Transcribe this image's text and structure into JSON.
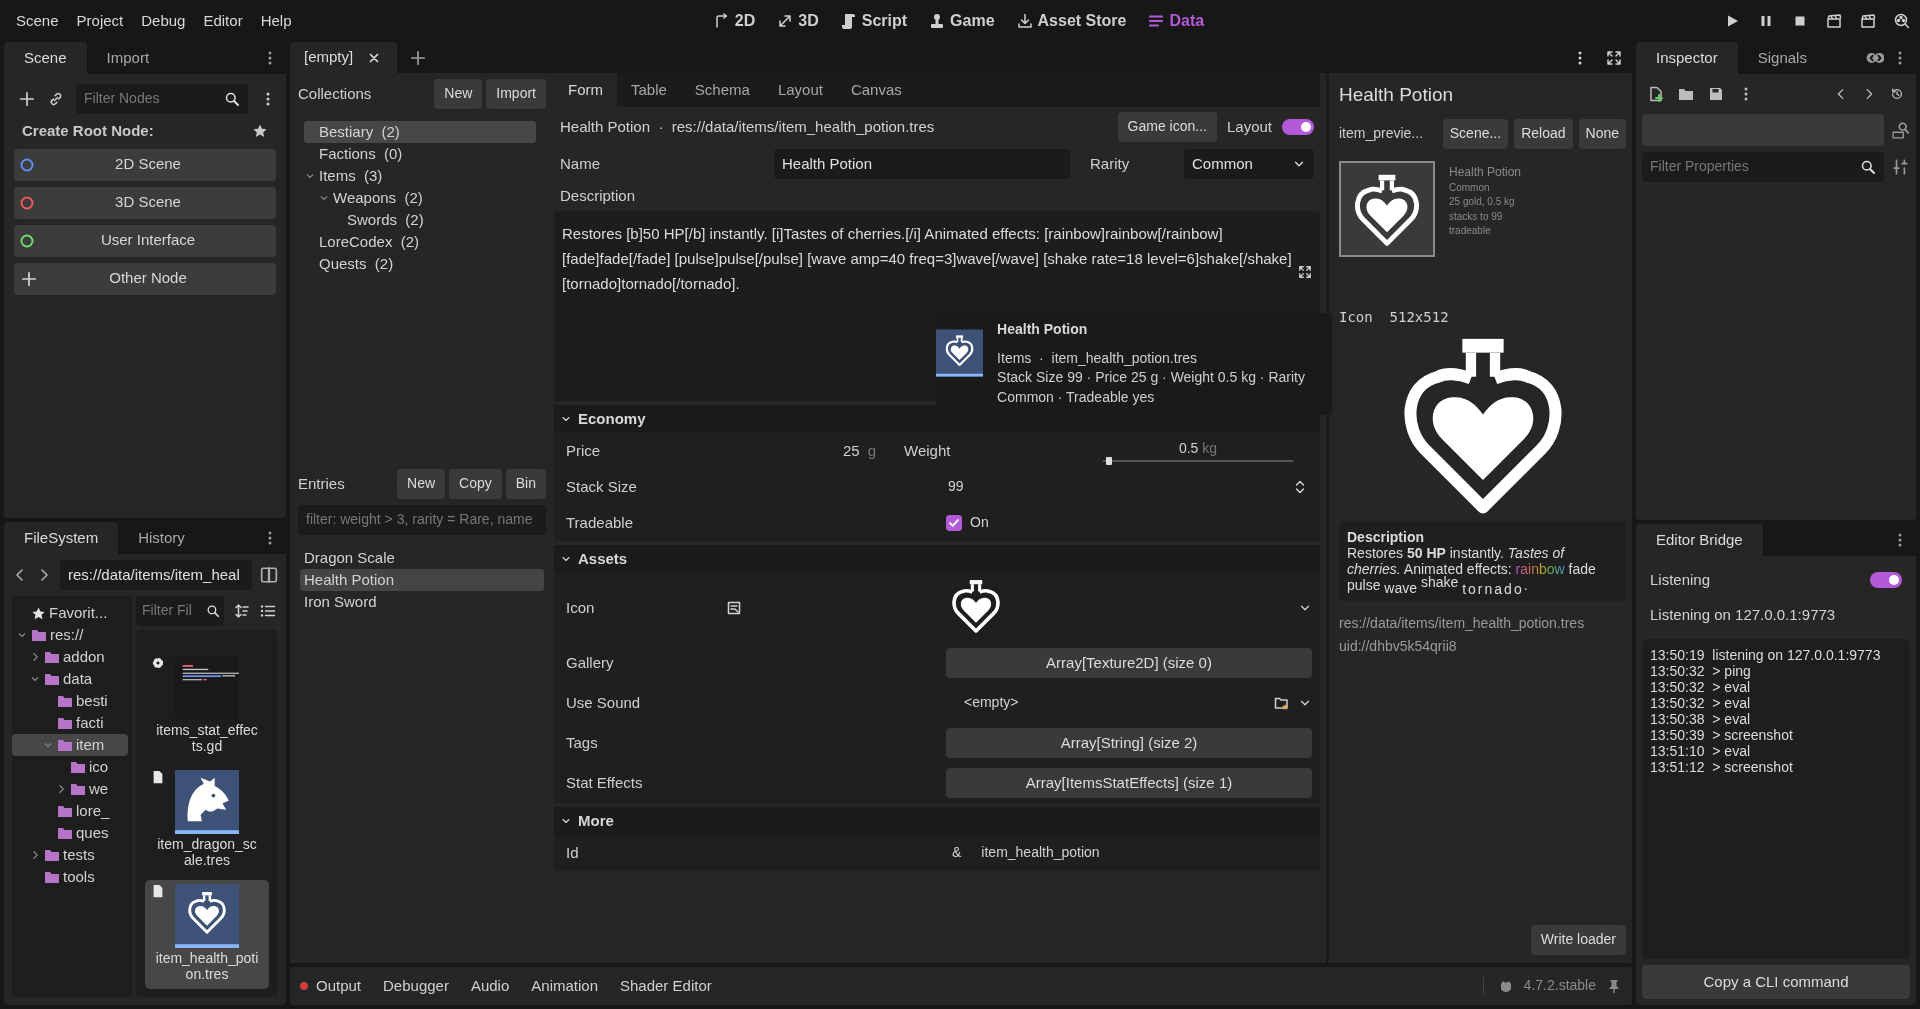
{
  "menu": [
    "Scene",
    "Project",
    "Debug",
    "Editor",
    "Help"
  ],
  "workspaces": [
    {
      "label": "2D",
      "kind": "flat",
      "selected": false
    },
    {
      "label": "3D",
      "kind": "spatial",
      "selected": false
    },
    {
      "label": "Script",
      "kind": "script",
      "selected": false
    },
    {
      "label": "Game",
      "kind": "game",
      "selected": false
    },
    {
      "label": "Asset Store",
      "kind": "store",
      "selected": false
    },
    {
      "label": "Data",
      "kind": "data",
      "selected": true
    }
  ],
  "scene_dock": {
    "tabs": [
      {
        "label": "Scene",
        "selected": true
      },
      {
        "label": "Import",
        "selected": false
      }
    ],
    "filter": {
      "placeholder": "Filter Nodes"
    },
    "heading": "Create Root Node:",
    "root_buttons": [
      {
        "label": "2D Scene",
        "kind": "circle",
        "color": "#5b8ff0"
      },
      {
        "label": "3D Scene",
        "kind": "circle",
        "color": "#ef5a5a"
      },
      {
        "label": "User Interface",
        "kind": "circle",
        "color": "#6fdc6f"
      },
      {
        "label": "Other Node",
        "kind": "plus"
      }
    ]
  },
  "filesystem": {
    "tabs": [
      {
        "label": "FileSystem",
        "selected": true
      },
      {
        "label": "History",
        "selected": false
      }
    ],
    "path": "res://data/items/item_heal",
    "tree": [
      {
        "label": "Favorit...",
        "kind": "favorites",
        "selected": false
      },
      {
        "label": "res://",
        "kind": "folder",
        "expanded": true,
        "selected": false,
        "children": [
          {
            "label": "addon",
            "kind": "folder",
            "expanded": false,
            "selected": false
          },
          {
            "label": "data",
            "kind": "folder",
            "expanded": true,
            "selected": false,
            "children": [
              {
                "label": "besti",
                "kind": "folder",
                "selected": false
              },
              {
                "label": "facti",
                "kind": "folder",
                "selected": false
              },
              {
                "label": "item",
                "kind": "folder",
                "expanded": true,
                "selected": true,
                "children": [
                  {
                    "label": "ico",
                    "kind": "folder",
                    "selected": false
                  },
                  {
                    "label": "we",
                    "kind": "folder",
                    "expanded": false,
                    "selected": false
                  }
                ]
              },
              {
                "label": "lore_",
                "kind": "folder",
                "selected": false
              },
              {
                "label": "ques",
                "kind": "folder",
                "selected": false
              }
            ]
          },
          {
            "label": "tests",
            "kind": "folder",
            "expanded": false,
            "selected": false
          },
          {
            "label": "tools",
            "kind": "folder",
            "selected": false
          }
        ]
      }
    ],
    "filter": {
      "placeholder": "Filter Fil"
    },
    "files": [
      {
        "name": "items_stat_effects.gd",
        "kind": "script",
        "selected": false
      },
      {
        "name": "item_dragon_scale.tres",
        "kind": "dragon",
        "selected": false
      },
      {
        "name": "item_health_potion.tres",
        "kind": "potion",
        "selected": true
      }
    ]
  },
  "scene_tabs": [
    {
      "label": "[empty]",
      "selected": true
    }
  ],
  "collections": {
    "title": "Collections",
    "buttons": [
      "New",
      "Import"
    ],
    "tree": [
      {
        "label": "Bestiary  (2)",
        "selected": true
      },
      {
        "label": "Factions  (0)",
        "selected": false
      },
      {
        "label": "Items  (3)",
        "expanded": true,
        "selected": false,
        "children": [
          {
            "label": "Weapons  (2)",
            "expanded": true,
            "selected": false,
            "children": [
              {
                "label": "Swords  (2)",
                "selected": false
              }
            ]
          }
        ]
      },
      {
        "label": "LoreCodex  (2)",
        "selected": false
      },
      {
        "label": "Quests  (2)",
        "selected": false
      }
    ]
  },
  "entries": {
    "title": "Entries",
    "buttons": [
      "New",
      "Copy",
      "Bin"
    ],
    "filter": {
      "placeholder": "filter: weight > 3, rarity = Rare, name"
    },
    "items": [
      {
        "label": "Dragon Scale",
        "selected": false
      },
      {
        "label": "Health Potion",
        "selected": true
      },
      {
        "label": "Iron Sword",
        "selected": false
      }
    ]
  },
  "form": {
    "tabs": [
      {
        "label": "Form",
        "selected": true
      },
      {
        "label": "Table",
        "selected": false
      },
      {
        "label": "Schema",
        "selected": false
      },
      {
        "label": "Layout",
        "selected": false
      },
      {
        "label": "Canvas",
        "selected": false
      }
    ],
    "breadcrumb": "Health Potion  ·  res://data/items/item_health_potion.tres",
    "icon_button": "Game icon...",
    "layout_toggle": {
      "label": "Layout",
      "on": true
    },
    "name": {
      "label": "Name",
      "value": "Health Potion"
    },
    "rarity": {
      "label": "Rarity",
      "value": "Common"
    },
    "description": {
      "label": "Description",
      "value": "Restores [b]50 HP[/b] instantly. [i]Tastes of cherries.[/i] Animated effects: [rainbow]rainbow[/rainbow] [fade]fade[/fade] [pulse]pulse[/pulse] [wave amp=40 freq=3]wave[/wave] [shake rate=18 level=6]shake[/shake] [tornado]tornado[/tornado]."
    },
    "sections": [
      {
        "title": "Economy",
        "expanded": true,
        "rows": [
          {
            "kind": "price",
            "label": "Price",
            "value": "25",
            "unit": "g",
            "label2": "Weight",
            "value2": "0.5",
            "unit2": "kg",
            "level": 0.03
          },
          {
            "kind": "spin",
            "label": "Stack Size",
            "value": "99"
          },
          {
            "kind": "check",
            "label": "Tradeable",
            "checked": true,
            "text": "On"
          }
        ]
      },
      {
        "title": "Assets",
        "expanded": true,
        "rows": [
          {
            "kind": "texture",
            "label": "Icon"
          },
          {
            "kind": "array",
            "label": "Gallery",
            "value": "Array[Texture2D] (size 0)"
          },
          {
            "kind": "resource",
            "label": "Use Sound",
            "value": "<empty>"
          },
          {
            "kind": "array",
            "label": "Tags",
            "value": "Array[String] (size 2)"
          },
          {
            "kind": "array",
            "label": "Stat Effects",
            "value": "Array[ItemsStatEffects] (size 1)"
          }
        ]
      },
      {
        "title": "More",
        "expanded": true,
        "rows": [
          {
            "kind": "id",
            "label": "Id",
            "prefix": "&",
            "value": "item_health_potion"
          }
        ]
      }
    ]
  },
  "tooltip": {
    "title": "Health Potion",
    "path": "Items  ·  item_health_potion.tres",
    "stats": "Stack Size 99  ·  Price 25 g  ·  Weight 0.5 kg  ·  Rarity Common  ·  Tradeable yes"
  },
  "preview": {
    "title": "Health Potion",
    "scene_label": "item_previe...",
    "buttons": [
      "Scene...",
      "Reload",
      "None"
    ],
    "card_lines": [
      "Health Potion",
      "Common",
      "25 gold, 0.5 kg",
      "stacks to 99",
      "tradeable"
    ],
    "icon_size": "Icon  512x512",
    "description": {
      "heading": "Description",
      "segments": [
        {
          "text": "Restores **50 HP** instantly. *Tastes of cherries.* Animated effects:",
          "kind": "plain"
        },
        {
          "text": "rainbow",
          "kind": "rainbow"
        },
        {
          "text": "fade",
          "kind": "plain"
        },
        {
          "text": "pulse",
          "kind": "plain"
        },
        {
          "text": "wave",
          "kind": "wave"
        },
        {
          "text": "shake",
          "kind": "shake"
        },
        {
          "text": "tornado",
          "kind": "tornado"
        },
        {
          "text": ".",
          "kind": "plain"
        }
      ]
    },
    "path": "res://data/items/item_health_potion.tres",
    "uid": "uid://dhbv5k54qrii8",
    "write_button": "Write loader"
  },
  "bottom_panel": {
    "tabs": [
      {
        "label": "Output",
        "alert": true
      },
      {
        "label": "Debugger",
        "alert": false
      },
      {
        "label": "Audio",
        "alert": false
      },
      {
        "label": "Animation",
        "alert": false
      },
      {
        "label": "Shader Editor",
        "alert": false
      }
    ],
    "version": "4.7.2.stable"
  },
  "inspector": {
    "tabs": [
      {
        "label": "Inspector",
        "selected": true
      },
      {
        "label": "Signals",
        "selected": false
      }
    ],
    "filter": {
      "placeholder": "Filter Properties"
    }
  },
  "bridge": {
    "tab": "Editor Bridge",
    "toggle": {
      "label": "Listening",
      "on": true
    },
    "status": "Listening on 127.0.0.1:9773",
    "log": [
      {
        "time": "13:50:19",
        "message": "listening on 127.0.0.1:9773"
      },
      {
        "time": "13:50:32",
        "message": "> ping"
      },
      {
        "time": "13:50:32",
        "message": "> eval"
      },
      {
        "time": "13:50:32",
        "message": "> eval"
      },
      {
        "time": "13:50:38",
        "message": "> eval"
      },
      {
        "time": "13:50:39",
        "message": "> screenshot"
      },
      {
        "time": "13:51:10",
        "message": "> eval"
      },
      {
        "time": "13:51:12",
        "message": "> screenshot"
      }
    ],
    "button": "Copy a CLI command"
  }
}
